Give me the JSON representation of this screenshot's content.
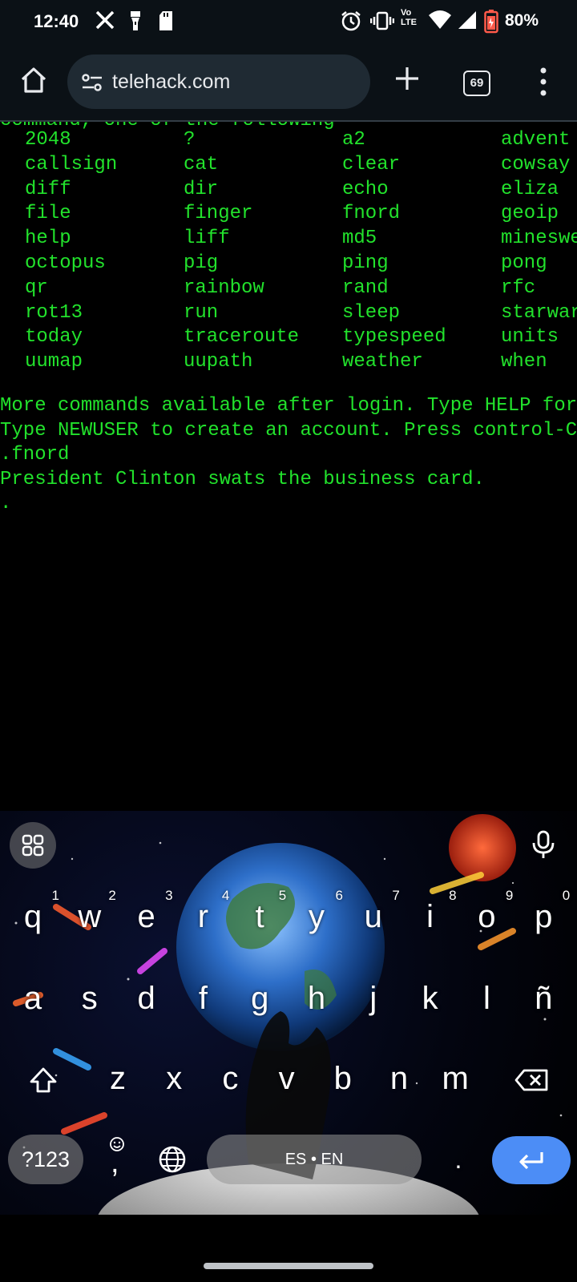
{
  "status_bar": {
    "time": "12:40",
    "notif_icons": [
      "x-logo-icon",
      "flashlight-icon",
      "sd-card-icon"
    ],
    "right_icons": [
      "alarm-icon",
      "vibrate-icon",
      "volte-icon",
      "wifi-icon",
      "signal-icon",
      "battery-icon"
    ],
    "volte_label": "Vo LTE",
    "battery": "80%"
  },
  "browser": {
    "url": "telehack.com",
    "tab_count": "69"
  },
  "terminal": {
    "partial_top_line": "command, one of the following",
    "commands": [
      [
        "2048",
        "?",
        "a2",
        "advent"
      ],
      [
        "callsign",
        "cat",
        "clear",
        "cowsay"
      ],
      [
        "diff",
        "dir",
        "echo",
        "eliza"
      ],
      [
        "file",
        "finger",
        "fnord",
        "geoip"
      ],
      [
        "help",
        "liff",
        "md5",
        "minesweeper"
      ],
      [
        "octopus",
        "pig",
        "ping",
        "pong"
      ],
      [
        "qr",
        "rainbow",
        "rand",
        "rfc"
      ],
      [
        "rot13",
        "run",
        "sleep",
        "starwars"
      ],
      [
        "today",
        "traceroute",
        "typespeed",
        "units"
      ],
      [
        "uumap",
        "uupath",
        "weather",
        "when"
      ]
    ],
    "lines": [
      "More commands available after login. Type HELP for a detailed command list.",
      "Type NEWUSER to create an account. Press control-C to interrupt any command.",
      ".fnord",
      "President Clinton swats the business card.",
      "."
    ],
    "text_color": "#22e22c"
  },
  "keyboard": {
    "row1": [
      {
        "ch": "q",
        "hint": "1"
      },
      {
        "ch": "w",
        "hint": "2"
      },
      {
        "ch": "e",
        "hint": "3"
      },
      {
        "ch": "r",
        "hint": "4"
      },
      {
        "ch": "t",
        "hint": "5"
      },
      {
        "ch": "y",
        "hint": "6"
      },
      {
        "ch": "u",
        "hint": "7"
      },
      {
        "ch": "i",
        "hint": "8"
      },
      {
        "ch": "o",
        "hint": "9"
      },
      {
        "ch": "p",
        "hint": "0"
      }
    ],
    "row2": [
      "a",
      "s",
      "d",
      "f",
      "g",
      "h",
      "j",
      "k",
      "l",
      "ñ"
    ],
    "row3": [
      "z",
      "x",
      "c",
      "v",
      "b",
      "n",
      "m"
    ],
    "symbols_label": "?123",
    "comma_label": ",",
    "space_label": "ES • EN",
    "period_label": ".",
    "enter_color": "#4c8df6"
  }
}
